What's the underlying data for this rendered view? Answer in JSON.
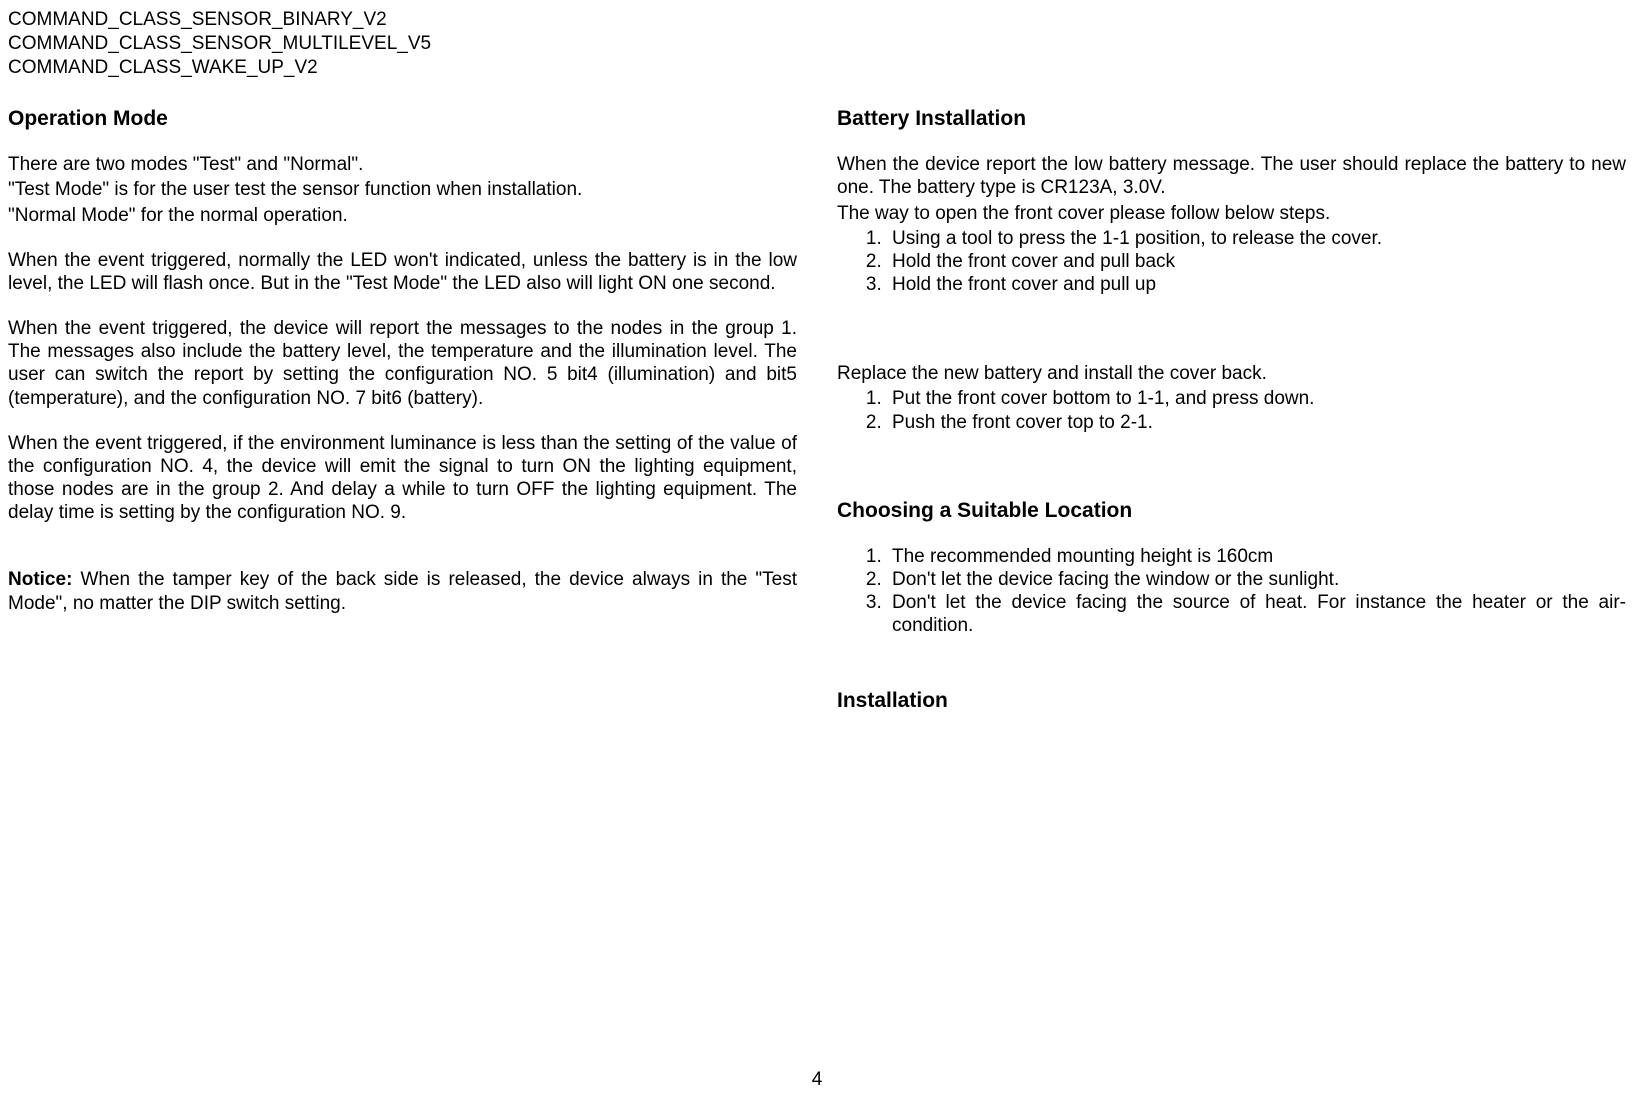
{
  "header": {
    "cmd1": "COMMAND_CLASS_SENSOR_BINARY_V2",
    "cmd2": "COMMAND_CLASS_SENSOR_MULTILEVEL_V5",
    "cmd3": "COMMAND_CLASS_WAKE_UP_V2"
  },
  "left": {
    "h1": "Operation Mode",
    "p1": "There are two modes \"Test\" and \"Normal\".",
    "p2": "\"Test Mode\" is for the user test the sensor function when installation.",
    "p3": "\"Normal Mode\" for the normal operation.",
    "p4": "When the event triggered, normally the LED won't indicated, unless the battery is in the low level, the LED will flash once. But in the \"Test Mode\" the LED also will light ON one second.",
    "p5": "When the event triggered, the device will report the messages to the nodes in the group 1. The messages also include the battery level, the temperature and the illumination level. The user can switch the report by setting the configuration NO. 5 bit4 (illumination) and bit5 (temperature), and the configuration NO. 7 bit6 (battery).",
    "p6": "When the event triggered, if the environment luminance is less than the setting of the value of the configuration NO. 4, the device will emit the signal to turn ON the lighting equipment, those nodes are in the group 2. And delay a while to turn OFF the lighting equipment. The delay time is setting by the configuration NO. 9.",
    "noticeLabel": "Notice:",
    "p7": " When the tamper key of the back side is released, the device always in the \"Test Mode\", no matter the DIP switch setting."
  },
  "right": {
    "h1": "Battery Installation",
    "p1": "When the device report the low battery message. The user should replace the battery to new one. The battery type is CR123A, 3.0V.",
    "p2": "The way to open the front cover please follow below steps.",
    "list1": {
      "i1": "Using a tool to press the 1-1 position, to release the cover.",
      "i2": "Hold the front cover and pull back",
      "i3": "Hold the front cover and pull up"
    },
    "p3": "Replace the new battery and install the cover back.",
    "list2": {
      "i1": "Put the front cover bottom to 1-1, and press down.",
      "i2": "Push the front cover top to 2-1."
    },
    "h2": "Choosing a Suitable Location",
    "list3": {
      "i1": "The recommended mounting height is 160cm",
      "i2": "Don't let the device facing the window or the sunlight.",
      "i3": "Don't let the device facing the source of heat. For instance the heater or the air-condition."
    },
    "h3": "Installation"
  },
  "pageNumber": "4"
}
